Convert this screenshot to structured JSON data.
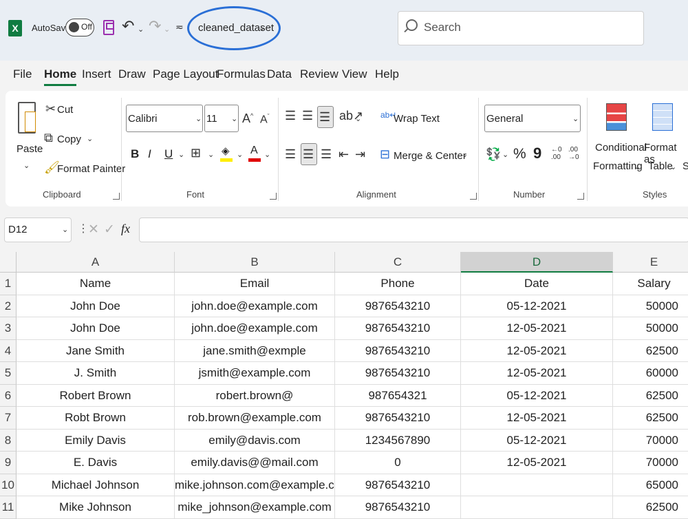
{
  "titlebar": {
    "autosave_label": "AutoSave",
    "autosave_state": "Off",
    "filename": "cleaned_dataset",
    "search_placeholder": "Search"
  },
  "menu": [
    "File",
    "Home",
    "Insert",
    "Draw",
    "Page Layout",
    "Formulas",
    "Data",
    "Review",
    "View",
    "Help"
  ],
  "ribbon": {
    "clipboard": {
      "paste": "Paste",
      "cut": "Cut",
      "copy": "Copy",
      "format_painter": "Format Painter",
      "label": "Clipboard"
    },
    "font": {
      "name": "Calibri",
      "size": "11",
      "label": "Font",
      "bold": "B",
      "italic": "I",
      "underline": "U"
    },
    "alignment": {
      "wrap_text": "Wrap Text",
      "merge_center": "Merge & Center",
      "label": "Alignment"
    },
    "number": {
      "format": "General",
      "label": "Number",
      "percent": "%",
      "comma": "9"
    },
    "styles": {
      "conditional_1": "Conditional",
      "conditional_2": "Formatting",
      "format_table_1": "Format as",
      "format_table_2": "Table",
      "label": "Styles",
      "cut_off": "S"
    }
  },
  "formula_bar": {
    "name_box": "D12",
    "fx": "fx",
    "cancel": "✕",
    "enter": "✓",
    "value": ""
  },
  "sheet": {
    "columns": [
      "A",
      "B",
      "C",
      "D",
      "E"
    ],
    "selected_column": "D",
    "rows": [
      {
        "n": "1",
        "cells": [
          "Name",
          "Email",
          "Phone",
          "Date",
          "Salary"
        ]
      },
      {
        "n": "2",
        "cells": [
          "John Doe",
          "john.doe@example.com",
          "9876543210",
          "05-12-2021",
          "50000"
        ]
      },
      {
        "n": "3",
        "cells": [
          "John Doe",
          "john.doe@example.com",
          "9876543210",
          "12-05-2021",
          "50000"
        ]
      },
      {
        "n": "4",
        "cells": [
          "Jane Smith",
          "jane.smith@exmple",
          "9876543210",
          "12-05-2021",
          "62500"
        ]
      },
      {
        "n": "5",
        "cells": [
          "J. Smith",
          "jsmith@example.com",
          "9876543210",
          "12-05-2021",
          "60000"
        ]
      },
      {
        "n": "6",
        "cells": [
          "Robert Brown",
          "robert.brown@",
          "987654321",
          "05-12-2021",
          "62500"
        ]
      },
      {
        "n": "7",
        "cells": [
          "Robt Brown",
          "rob.brown@example.com",
          "9876543210",
          "12-05-2021",
          "62500"
        ]
      },
      {
        "n": "8",
        "cells": [
          "Emily Davis",
          "emily@davis.com",
          "1234567890",
          "05-12-2021",
          "70000"
        ]
      },
      {
        "n": "9",
        "cells": [
          "E. Davis",
          "emily.davis@@mail.com",
          "0",
          "12-05-2021",
          "70000"
        ]
      },
      {
        "n": "10",
        "cells": [
          "Michael Johnson",
          "mike.johnson.com@example.com",
          "9876543210",
          "",
          "65000"
        ]
      },
      {
        "n": "11",
        "cells": [
          "Mike Johnson",
          "mike_johnson@example.com",
          "9876543210",
          "",
          "62500"
        ]
      }
    ]
  },
  "colors": {
    "excel_green": "#107c41",
    "annotation_blue": "#2a6fd6",
    "save_purple": "#9b2fae"
  }
}
